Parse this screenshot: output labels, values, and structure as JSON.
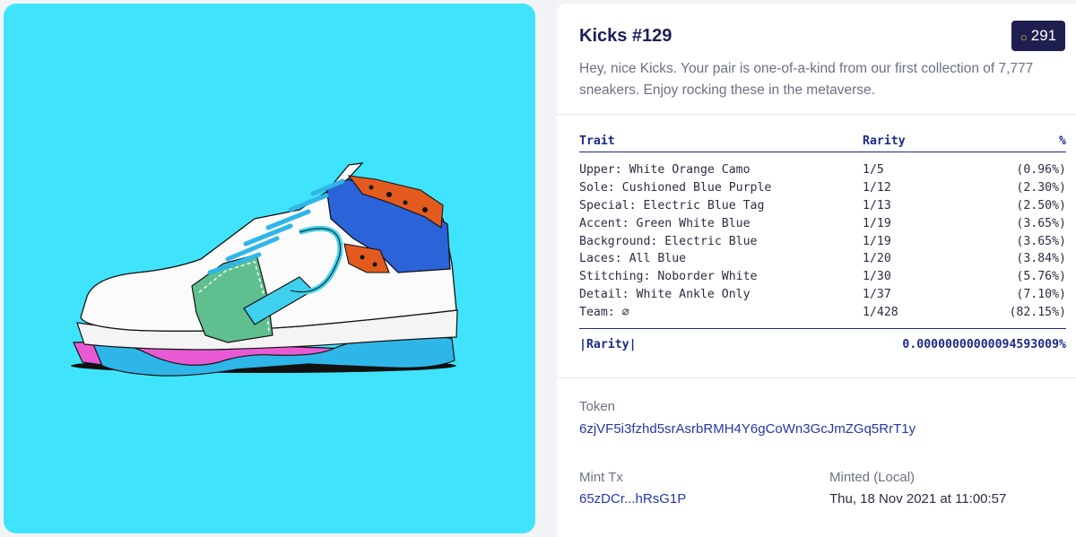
{
  "nft": {
    "title": "Kicks #129",
    "rank": "291",
    "rank_icon": "rank-icon",
    "description": "Hey, nice Kicks. Your pair is one-of-a-kind from our first collection of 7,777 sneakers. Enjoy rocking these in the metaverse."
  },
  "traits": {
    "headers": {
      "trait": "Trait",
      "rarity": "Rarity",
      "percent": "%"
    },
    "rows": [
      {
        "trait": "Upper: White Orange Camo",
        "rarity": "1/5",
        "percent": "(0.96%)"
      },
      {
        "trait": "Sole: Cushioned Blue Purple",
        "rarity": "1/12",
        "percent": "(2.30%)"
      },
      {
        "trait": "Special: Electric Blue Tag",
        "rarity": "1/13",
        "percent": "(2.50%)"
      },
      {
        "trait": "Accent: Green White Blue",
        "rarity": "1/19",
        "percent": "(3.65%)"
      },
      {
        "trait": "Background: Electric Blue",
        "rarity": "1/19",
        "percent": "(3.65%)"
      },
      {
        "trait": "Laces: All Blue",
        "rarity": "1/20",
        "percent": "(3.84%)"
      },
      {
        "trait": "Stitching: Noborder White",
        "rarity": "1/30",
        "percent": "(5.76%)"
      },
      {
        "trait": "Detail: White Ankle Only",
        "rarity": "1/37",
        "percent": "(7.10%)"
      },
      {
        "trait": "Team: ∅",
        "rarity": "1/428",
        "percent": "(82.15%)"
      }
    ],
    "footer": {
      "label": "|Rarity|",
      "value": "0.00000000000094593009%"
    }
  },
  "token": {
    "label": "Token",
    "value": "6zjVF5i3fzhd5srAsrbRMH4Y6gCoWn3GcJmZGq5RrT1y"
  },
  "mint": {
    "tx_label": "Mint Tx",
    "tx_value": "65zDCr...hRsG1P",
    "date_label": "Minted (Local)",
    "date_value": "Thu, 18 Nov 2021 at 11:00:57"
  },
  "colors": {
    "background": "#3fe4fc",
    "accent": "#2438a8",
    "badge": "#1f1f4f"
  }
}
